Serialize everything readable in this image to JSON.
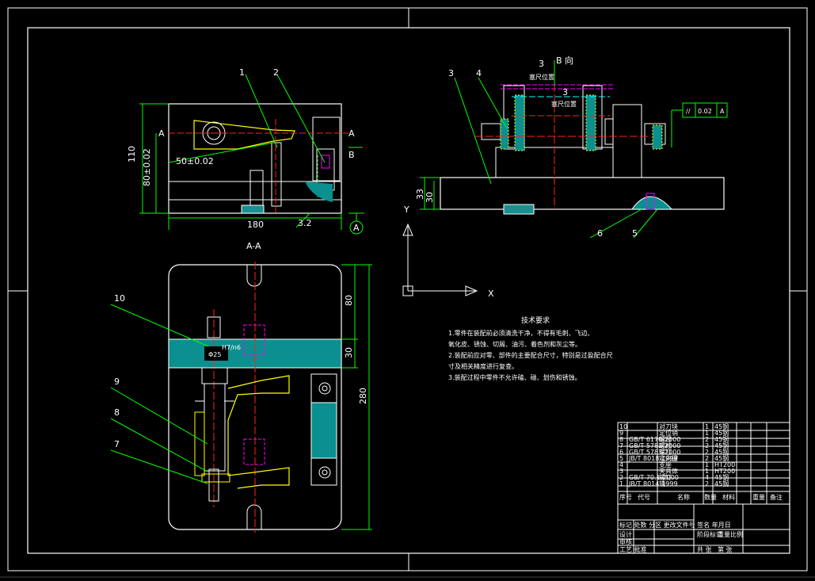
{
  "drawing": {
    "top_view_labels": {
      "part1": "1",
      "part2": "2",
      "section_mark_left": "A",
      "section_mark_right": "A",
      "view_b": "B",
      "dim_height_total": "110",
      "dim_height": "80±0.02",
      "dim_center": "50±0.02",
      "dim_width": "180",
      "surface_roughness": "3.2",
      "datum": "A"
    },
    "section_view": {
      "title": "A-A",
      "part7": "7",
      "part8": "8",
      "part9": "9",
      "part10": "10",
      "dim_diameter": "Φ25",
      "dim_fit": "H7/n6",
      "dim_80": "80",
      "dim_30": "30",
      "dim_280": "280"
    },
    "side_view": {
      "part3": "3",
      "part4": "4",
      "part5": "5",
      "part6": "6",
      "view_label": "B 向",
      "feeler_label_1": "塞尺位置",
      "feeler_label_2": "塞尺位置",
      "feeler_3a": "3",
      "feeler_3b": "3",
      "dim_33": "33",
      "dim_30": "30",
      "tolerance_symbol": "//",
      "tolerance_value": "0.02",
      "tolerance_datum": "A"
    },
    "ucs": {
      "y_label": "Y",
      "x_label": "X"
    }
  },
  "technical_requirements": {
    "title": "技术要求",
    "lines": [
      "1.零件在装配前必须清洗干净，不得有毛刺、飞边、",
      "氧化皮、锈蚀、切屑、油污、着色剂和灰尘等。",
      "2.装配前应对零、部件的主要配合尺寸，特别是过盈配合尺",
      "寸及相关精度进行复查。",
      "3.装配过程中零件不允许磕、碰、划伤和锈蚀。"
    ]
  },
  "title_block": {
    "header": [
      "序号",
      "代号",
      "名称",
      "数量",
      "材料",
      "单件 总计 重量",
      "备注"
    ],
    "header_short": [
      "序号",
      "代号",
      "名称",
      "数量",
      "材料",
      "重量",
      "备注"
    ],
    "rows": [
      [
        "10",
        "",
        "对刀块",
        "1",
        "45钢"
      ],
      [
        "9",
        "",
        "定位销",
        "1",
        "45钢"
      ],
      [
        "8",
        "GB/T 6170-2000",
        "螺母",
        "2",
        "45钢"
      ],
      [
        "7",
        "GB/T 5782-2000",
        "螺栓",
        "2",
        "45钢"
      ],
      [
        "6",
        "GB/T 5783-2000",
        "螺钉",
        "2",
        "45钢"
      ],
      [
        "5",
        "JB/T 8018-1999",
        "定向键",
        "2",
        "45钢"
      ],
      [
        "4",
        "",
        "支座",
        "1",
        "HT200"
      ],
      [
        "3",
        "",
        "夹具体",
        "1",
        "HT200"
      ],
      [
        "2",
        "GB/T 70.1-2000",
        "螺钉",
        "4",
        "45钢"
      ],
      [
        "1",
        "JB/T 8014-1999",
        "销",
        "2",
        "45钢"
      ]
    ],
    "sign_rows": [
      "标记 处数 分区 更改文件号 签名 年月日",
      "设计",
      "审核",
      "工艺 批准"
    ],
    "stage_labels": [
      "阶段标记",
      "重量",
      "比例"
    ],
    "sheet_labels": [
      "共 张",
      "第 张"
    ]
  }
}
